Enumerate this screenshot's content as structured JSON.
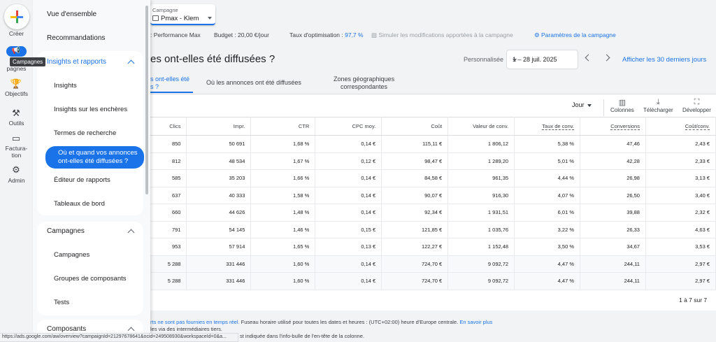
{
  "rail": {
    "create_label": "Créer",
    "campaigns_label": "pagnes",
    "tooltip": "Campagnes",
    "goals_label": "Objectifs",
    "tools_label": "Outils",
    "billing_label_1": "Factura-",
    "billing_label_2": "tion",
    "admin_label": "Admin"
  },
  "nav": {
    "overview": "Vue d'ensemble",
    "recommendations": "Recommandations",
    "insights_group": "Insights et rapports",
    "insights_items": [
      "Insights",
      "Insights sur les enchères",
      "Termes de recherche",
      "Où et quand vos annonces ont-elles été diffusées ?",
      "Éditeur de rapports",
      "Tableaux de bord"
    ],
    "campaigns_group": "Campagnes",
    "campaigns_items": [
      "Campagnes",
      "Groupes de composants",
      "Tests"
    ],
    "components_group": "Composants"
  },
  "campaign_select": {
    "label": "Campagne",
    "value": "Pmax - Klem"
  },
  "info": {
    "type": ": Performance Max",
    "budget": "Budget : 20,00 €/jour",
    "opt_label": "Taux d'optimisation : ",
    "opt_value": "97,7 %",
    "simulate": "Simuler les modifications apportées à la campagne",
    "settings": "Paramètres de la campagne"
  },
  "header": {
    "title": "es ont-elles été diffusées ?",
    "persona": "Personnalisée",
    "date_range": "1 – 28 juil. 2025",
    "last30": "Afficher les 30 derniers jours"
  },
  "tabs": {
    "active_1": "s ont-elles été",
    "active_2": "s ?",
    "where": "Où les annonces ont été diffusées",
    "geo_1": "Zones géographiques",
    "geo_2": "correspondantes"
  },
  "toolbar": {
    "segment": "Jour",
    "columns": "Colonnes",
    "download": "Télécharger",
    "expand": "Développer"
  },
  "table": {
    "headers": [
      "Clics",
      "Impr.",
      "CTR",
      "CPC moy.",
      "Coût",
      "Valeur de conv.",
      "Taux de conv.",
      "Conversions",
      "Coût/conv."
    ],
    "rows": [
      [
        "850",
        "50 691",
        "1,68 %",
        "0,14 €",
        "115,11 €",
        "1 806,12",
        "5,38 %",
        "47,46",
        "2,43 €"
      ],
      [
        "812",
        "48 534",
        "1,67 %",
        "0,12 €",
        "98,47 €",
        "1 289,20",
        "5,01 %",
        "42,28",
        "2,33 €"
      ],
      [
        "585",
        "35 203",
        "1,66 %",
        "0,14 €",
        "84,58 €",
        "961,35",
        "4,44 %",
        "26,98",
        "3,13 €"
      ],
      [
        "637",
        "40 333",
        "1,58 %",
        "0,14 €",
        "90,07 €",
        "916,30",
        "4,07 %",
        "26,50",
        "3,40 €"
      ],
      [
        "660",
        "44 626",
        "1,48 %",
        "0,14 €",
        "92,34 €",
        "1 931,51",
        "6,01 %",
        "39,88",
        "2,32 €"
      ],
      [
        "791",
        "54 145",
        "1,46 %",
        "0,15 €",
        "121,85 €",
        "1 035,76",
        "3,22 %",
        "26,33",
        "4,63 €"
      ],
      [
        "953",
        "57 914",
        "1,65 %",
        "0,13 €",
        "122,27 €",
        "1 152,48",
        "3,50 %",
        "34,67",
        "3,53 €"
      ]
    ],
    "totals": [
      [
        "5 288",
        "331 446",
        "1,60 %",
        "0,14 €",
        "724,70 €",
        "9 092,72",
        "4,47 %",
        "244,11",
        "2,97 €"
      ],
      [
        "5 288",
        "331 446",
        "1,60 %",
        "0,14 €",
        "724,70 €",
        "9 092,72",
        "4,47 %",
        "244,11",
        "2,97 €"
      ]
    ],
    "pager": "1 à 7 sur 7"
  },
  "footer": {
    "line1_link": "rts ne sont pas fournies en temps réel.",
    "line1_text": " Fuseau horaire utilisé pour toutes les dates et heures : (UTC+02:00) heure d'Europe centrale. ",
    "line1_more": "En savoir plus",
    "line2": "les via des intermédiaires tiers.",
    "line3": "st indiquée dans l'info-bulle de l'en-tête de la colonne."
  },
  "statusbar": "https://ads.google.com/aw/overview?campaignId=21297678641&ocid=249508930&workspaceId=0&a..."
}
